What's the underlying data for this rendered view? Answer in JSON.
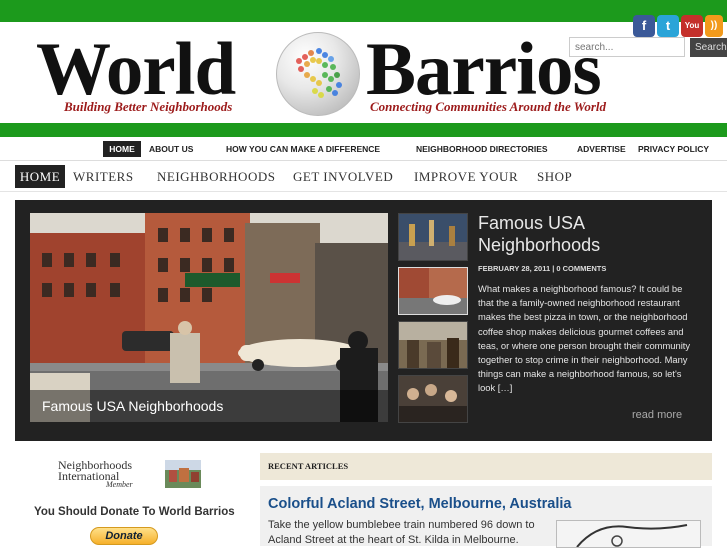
{
  "header": {
    "logo_left": "World",
    "logo_right": "Barrios",
    "tagline_left": "Building Better Neighborhoods",
    "tagline_right": "Connecting Communities Around the World",
    "search_placeholder": "search...",
    "search_button": "Search",
    "social_icons": [
      "facebook-icon",
      "twitter-icon",
      "youtube-icon",
      "rss-icon"
    ],
    "youtube_label": "You",
    "brand_green": "#1c9a1c"
  },
  "top_nav": [
    "HOME",
    "ABOUT US",
    "HOW YOU CAN MAKE A DIFFERENCE",
    "NEIGHBORHOOD DIRECTORIES",
    "ADVERTISE",
    "PRIVACY POLICY"
  ],
  "cat_nav": [
    "HOME",
    "WRITERS",
    "NEIGHBORHOODS",
    "GET INVOLVED",
    "IMPROVE YOUR",
    "SHOP"
  ],
  "featured": {
    "caption": "Famous USA Neighborhoods",
    "title": "Famous USA Neighborhoods",
    "meta": "FEBRUARY 28, 2011 | 0 COMMENTS",
    "body": "What makes a neighborhood famous? It could be that the a family-owned neighborhood restaurant makes the best pizza in town, or the neighborhood coffee shop makes delicious gourmet coffees and teas, or where one person brought their community together to stop crime in their neighborhood. Many things can make a neighborhood famous, so let's look […]",
    "read_more": "read more"
  },
  "sidebar": {
    "ni_logo_line1": "Neighborhoods",
    "ni_logo_line2": "International",
    "ni_logo_line3": "Member",
    "donate_title": "You Should Donate To World Barrios",
    "donate_button": "Donate"
  },
  "recent": {
    "heading": "RECENT ARTICLES",
    "article_title": "Colorful Acland Street, Melbourne, Australia",
    "article_body": "Take the yellow bumblebee train numbered 96 down to Acland Street at the heart of St. Kilda in Melbourne."
  }
}
